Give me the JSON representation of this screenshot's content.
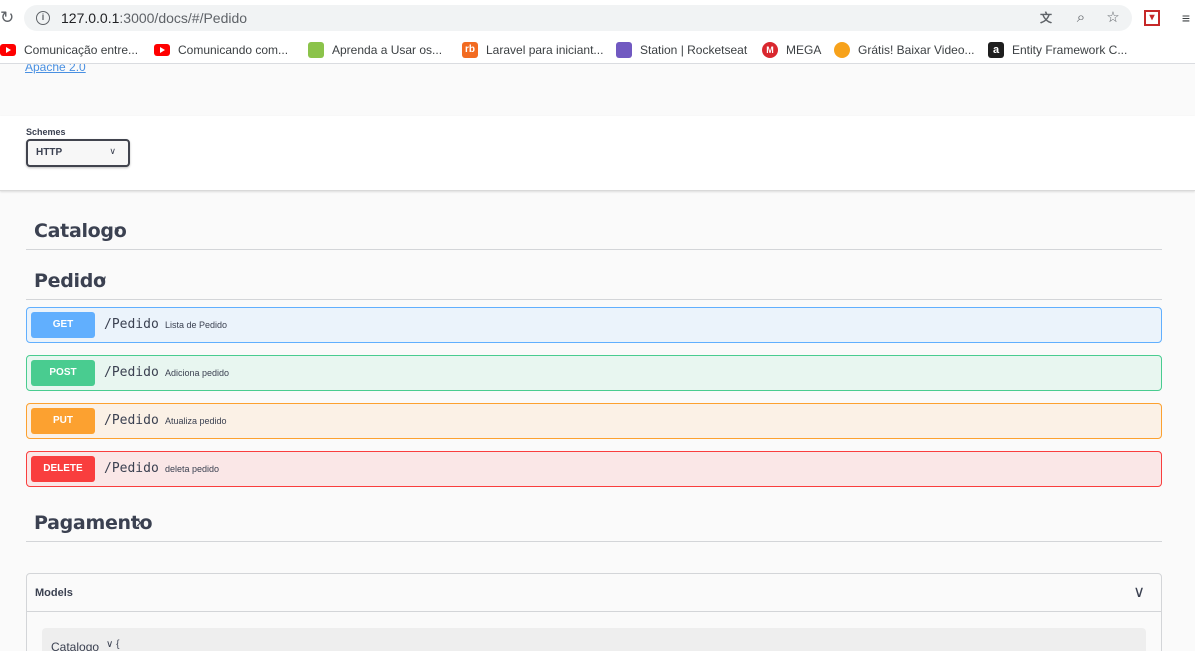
{
  "browser": {
    "url_host": "127.0.0.1",
    "url_rest": ":3000/docs/#/Pedido",
    "bookmarks": [
      {
        "label": "Comunicação entre...",
        "icon": "youtube-icon",
        "color": "#ff0000"
      },
      {
        "label": "Comunicando com...",
        "icon": "youtube-icon",
        "color": "#ff0000"
      },
      {
        "label": "Aprenda a Usar os...",
        "icon": "android-icon",
        "color": "#8bc34a"
      },
      {
        "label": "Laravel para iniciant...",
        "icon": "rb-icon",
        "color": "#f26b21"
      },
      {
        "label": "Station | Rocketseat",
        "icon": "rocketseat-icon",
        "color": "#7159c1"
      },
      {
        "label": "MEGA",
        "icon": "mega-icon",
        "color": "#d9272e"
      },
      {
        "label": "Grátis! Baixar Video...",
        "icon": "video-icon",
        "color": "#f7a21b"
      },
      {
        "label": "Entity Framework C...",
        "icon": "entity-icon",
        "color": "#1e1e1e"
      }
    ]
  },
  "info": {
    "license": "Apache 2.0"
  },
  "schemes": {
    "label": "Schemes",
    "selected": "HTTP"
  },
  "tags": [
    {
      "name": "Catalogo",
      "expanded": false
    },
    {
      "name": "Pedido",
      "expanded": true
    },
    {
      "name": "Pagamento",
      "expanded": false
    }
  ],
  "operations": [
    {
      "method": "GET",
      "path": "/Pedido",
      "summary": "Lista de Pedido",
      "color": "#61affe",
      "bg": "#ebf3fb"
    },
    {
      "method": "POST",
      "path": "/Pedido",
      "summary": "Adiciona pedido",
      "color": "#49cc90",
      "bg": "#e8f6f0"
    },
    {
      "method": "PUT",
      "path": "/Pedido",
      "summary": "Atualiza pedido",
      "color": "#fca130",
      "bg": "#fbf1e6"
    },
    {
      "method": "DELETE",
      "path": "/Pedido",
      "summary": "deleta pedido",
      "color": "#f93e3e",
      "bg": "#fae7e7"
    }
  ],
  "models": {
    "title": "Models",
    "items": [
      {
        "name": "Catalogo"
      }
    ]
  }
}
